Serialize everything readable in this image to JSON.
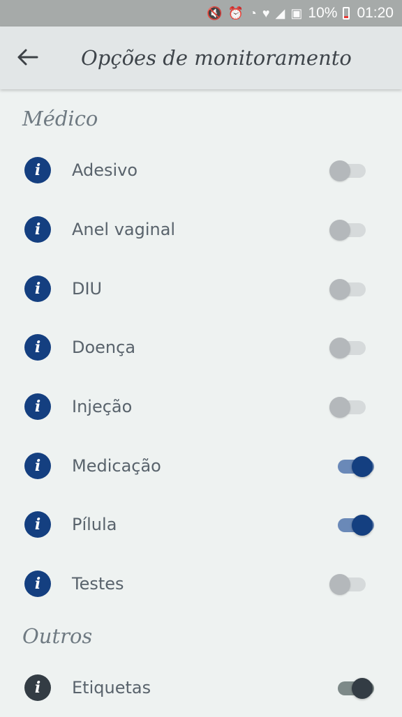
{
  "status_bar": {
    "icons": [
      "mute-icon",
      "alarm-icon",
      "wifi-icon",
      "health-icon",
      "signal-icon",
      "photo-icon"
    ],
    "battery": "10%",
    "time": "01:20"
  },
  "app_bar": {
    "title": "Opções de monitoramento",
    "back_icon": "arrow-left-icon"
  },
  "sections": [
    {
      "title": "Médico",
      "items": [
        {
          "label": "Adesivo",
          "enabled": false
        },
        {
          "label": "Anel vaginal",
          "enabled": false
        },
        {
          "label": "DIU",
          "enabled": false
        },
        {
          "label": "Doença",
          "enabled": false
        },
        {
          "label": "Injeção",
          "enabled": false
        },
        {
          "label": "Medicação",
          "enabled": true
        },
        {
          "label": "Pílula",
          "enabled": true
        },
        {
          "label": "Testes",
          "enabled": false
        }
      ]
    },
    {
      "title": "Outros",
      "items": [
        {
          "label": "Etiquetas",
          "enabled": true
        }
      ]
    }
  ],
  "info_glyph": "i",
  "colors": {
    "accent": "#143f80",
    "dark_accent": "#333c44",
    "background": "#eef2f1",
    "status_bar": "#a6aaa9",
    "app_bar": "#e2e6e7"
  }
}
